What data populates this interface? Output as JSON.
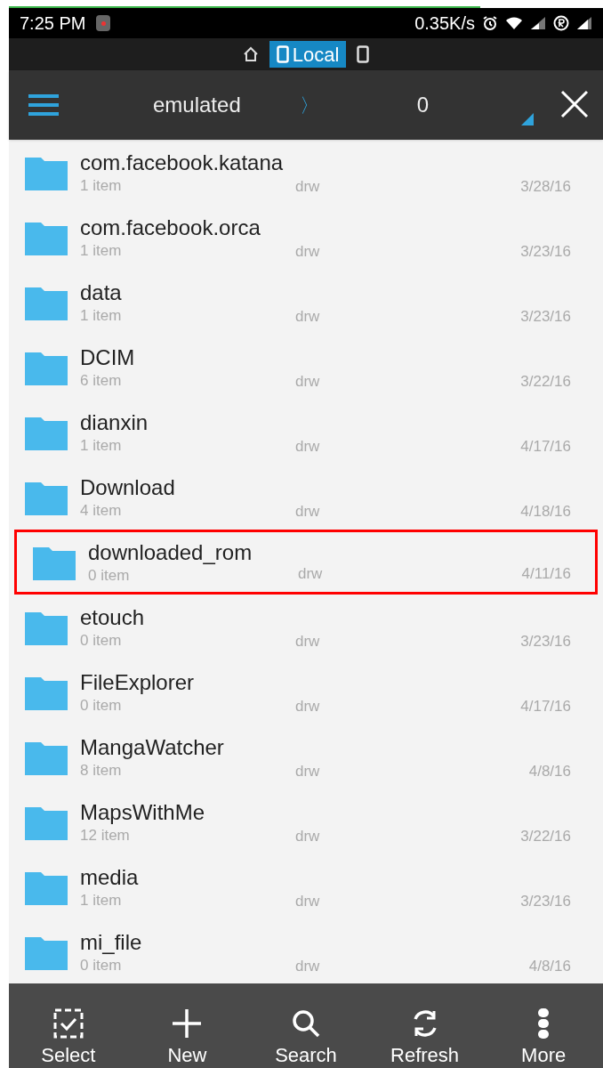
{
  "status_bar": {
    "time": "7:25 PM",
    "speed": "0.35K/s"
  },
  "location_tabs": [
    {
      "kind": "home",
      "selected": false
    },
    {
      "kind": "local",
      "label": "Local",
      "selected": true
    },
    {
      "kind": "device",
      "selected": false
    }
  ],
  "header": {
    "path": "emulated",
    "separator": "〉",
    "count": "0"
  },
  "files": [
    {
      "name": "com.facebook.katana",
      "items": "1 item",
      "permissions": "drw",
      "date": "3/28/16",
      "highlighted": false
    },
    {
      "name": "com.facebook.orca",
      "items": "1 item",
      "permissions": "drw",
      "date": "3/23/16",
      "highlighted": false
    },
    {
      "name": "data",
      "items": "1 item",
      "permissions": "drw",
      "date": "3/23/16",
      "highlighted": false
    },
    {
      "name": "DCIM",
      "items": "6 item",
      "permissions": "drw",
      "date": "3/22/16",
      "highlighted": false
    },
    {
      "name": "dianxin",
      "items": "1 item",
      "permissions": "drw",
      "date": "4/17/16",
      "highlighted": false
    },
    {
      "name": "Download",
      "items": "4 item",
      "permissions": "drw",
      "date": "4/18/16",
      "highlighted": false
    },
    {
      "name": "downloaded_rom",
      "items": "0 item",
      "permissions": "drw",
      "date": "4/11/16",
      "highlighted": true
    },
    {
      "name": "etouch",
      "items": "0 item",
      "permissions": "drw",
      "date": "3/23/16",
      "highlighted": false
    },
    {
      "name": "FileExplorer",
      "items": "0 item",
      "permissions": "drw",
      "date": "4/17/16",
      "highlighted": false
    },
    {
      "name": "MangaWatcher",
      "items": "8 item",
      "permissions": "drw",
      "date": "4/8/16",
      "highlighted": false
    },
    {
      "name": "MapsWithMe",
      "items": "12 item",
      "permissions": "drw",
      "date": "3/22/16",
      "highlighted": false
    },
    {
      "name": "media",
      "items": "1 item",
      "permissions": "drw",
      "date": "3/23/16",
      "highlighted": false
    },
    {
      "name": "mi_file",
      "items": "0 item",
      "permissions": "drw",
      "date": "4/8/16",
      "highlighted": false
    }
  ],
  "toolbar": [
    {
      "kind": "select",
      "label": "Select"
    },
    {
      "kind": "new",
      "label": "New"
    },
    {
      "kind": "search",
      "label": "Search"
    },
    {
      "kind": "refresh",
      "label": "Refresh"
    },
    {
      "kind": "more",
      "label": "More"
    }
  ]
}
